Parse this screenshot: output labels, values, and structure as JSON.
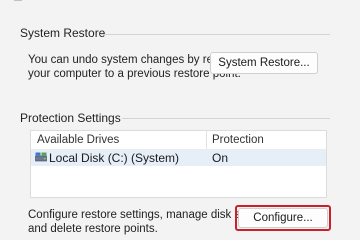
{
  "system_restore": {
    "title": "System Restore",
    "description_line1": "You can undo system changes by reverting",
    "description_line2": "your computer to a previous restore point.",
    "button_label": "System Restore..."
  },
  "protection": {
    "title": "Protection Settings",
    "columns": [
      "Available Drives",
      "Protection"
    ],
    "rows": [
      {
        "drive": "Local Disk (C:) (System)",
        "protection": "On",
        "icon": "drive-icon"
      }
    ],
    "configure_line1": "Configure restore settings, manage disk space,",
    "configure_line2": "and delete restore points.",
    "configure_button": "Configure..."
  },
  "colors": {
    "background": "#f3f3f3",
    "highlight_ring": "#c8212b",
    "selected_row": "#e6eef8"
  }
}
